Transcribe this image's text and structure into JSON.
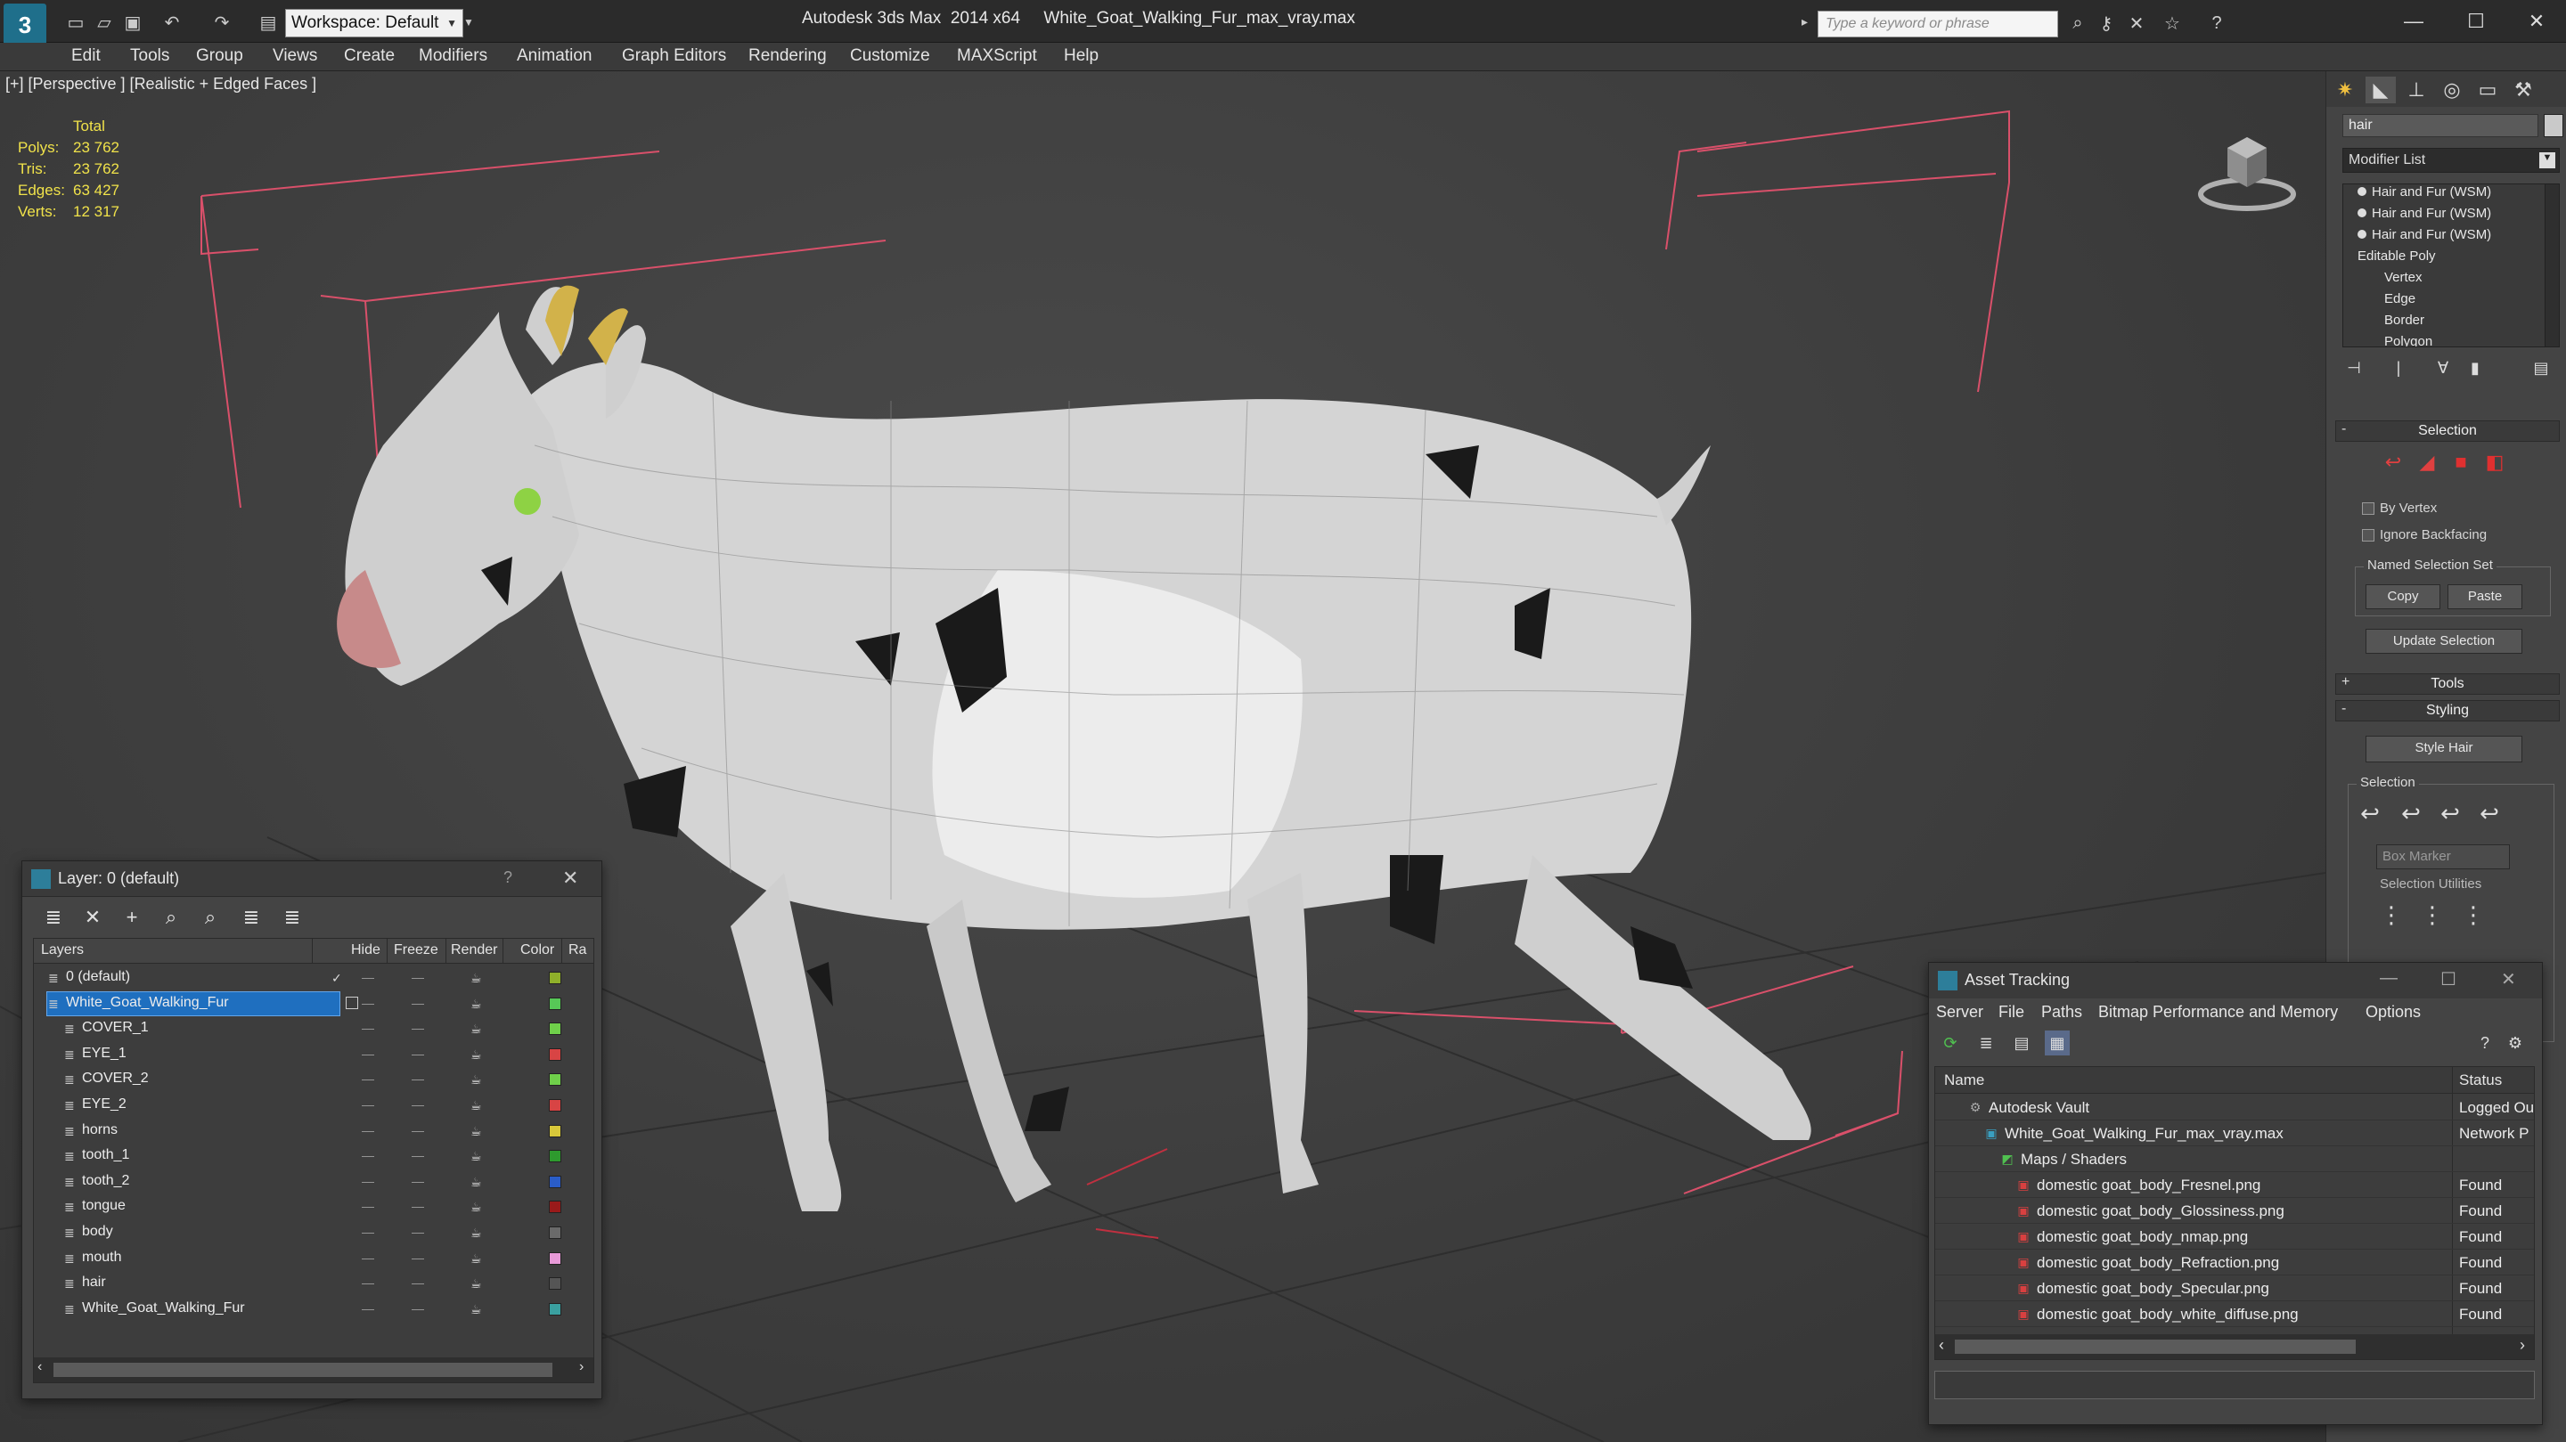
{
  "app": {
    "title": "Autodesk 3ds Max  2014 x64     White_Goat_Walking_Fur_max_vray.max",
    "workspace": "Workspace: Default",
    "search_placeholder": "Type a keyword or phrase"
  },
  "menus": [
    "Edit",
    "Tools",
    "Group",
    "Views",
    "Create",
    "Modifiers",
    "Animation",
    "Graph Editors",
    "Rendering",
    "Customize",
    "MAXScript",
    "Help"
  ],
  "viewport": {
    "label": "[+] [Perspective ] [Realistic + Edged Faces ]",
    "stats": {
      "header": "Total",
      "polys_label": "Polys:",
      "polys": "23 762",
      "tris_label": "Tris:",
      "tris": "23 762",
      "edges_label": "Edges:",
      "edges": "63 427",
      "verts_label": "Verts:",
      "verts": "12 317"
    }
  },
  "command_panel": {
    "object_name": "hair",
    "modifier_list": "Modifier List",
    "stack": [
      "Hair and Fur (WSM)",
      "Hair and Fur (WSM)",
      "Hair and Fur (WSM)",
      "Editable Poly",
      "Vertex",
      "Edge",
      "Border",
      "Polygon"
    ],
    "selection_rollout": "Selection",
    "by_vertex": "By Vertex",
    "ignore_backfacing": "Ignore Backfacing",
    "named_selection_set": "Named Selection Set",
    "copy": "Copy",
    "paste": "Paste",
    "update_selection": "Update Selection",
    "tools_rollout": "Tools",
    "styling_rollout": "Styling",
    "style_hair": "Style Hair",
    "selection_group": "Selection",
    "box_marker": "Box Marker",
    "selection_utilities": "Selection Utilities"
  },
  "layer_dialog": {
    "title": "Layer: 0 (default)",
    "help": "?",
    "columns": [
      "Layers",
      "Hide",
      "Freeze",
      "Render",
      "Color",
      "Ra"
    ],
    "rows": [
      {
        "name": "0 (default)",
        "color": "#8fb02a",
        "level": 0
      },
      {
        "name": "White_Goat_Walking_Fur",
        "color": "#57c857",
        "level": 0
      },
      {
        "name": "COVER_1",
        "color": "#6fd04a",
        "level": 1
      },
      {
        "name": "EYE_1",
        "color": "#d84444",
        "level": 1
      },
      {
        "name": "COVER_2",
        "color": "#6fd04a",
        "level": 1
      },
      {
        "name": "EYE_2",
        "color": "#d84444",
        "level": 1
      },
      {
        "name": "horns",
        "color": "#d8c83a",
        "level": 1
      },
      {
        "name": "tooth_1",
        "color": "#2e9a2e",
        "level": 1
      },
      {
        "name": "tooth_2",
        "color": "#2a5dc8",
        "level": 1
      },
      {
        "name": "tongue",
        "color": "#9a1a1a",
        "level": 1
      },
      {
        "name": "body",
        "color": "#6a6a6a",
        "level": 1
      },
      {
        "name": "mouth",
        "color": "#e89ad8",
        "level": 1
      },
      {
        "name": "hair",
        "color": "#555555",
        "level": 1
      },
      {
        "name": "White_Goat_Walking_Fur",
        "color": "#3aa0a0",
        "level": 1
      }
    ]
  },
  "asset_tracking": {
    "title": "Asset Tracking",
    "menus": [
      "Server",
      "File",
      "Paths",
      "Bitmap Performance and Memory",
      "Options"
    ],
    "col_name": "Name",
    "col_status": "Status",
    "rows": [
      {
        "name": "Autodesk Vault",
        "status": "Logged Ou",
        "level": 1,
        "icon": "vault"
      },
      {
        "name": "White_Goat_Walking_Fur_max_vray.max",
        "status": "Network P",
        "level": 2,
        "icon": "max"
      },
      {
        "name": "Maps / Shaders",
        "status": "",
        "level": 3,
        "icon": "maps"
      },
      {
        "name": "domestic goat_body_Fresnel.png",
        "status": "Found",
        "level": 4,
        "icon": "png"
      },
      {
        "name": "domestic goat_body_Glossiness.png",
        "status": "Found",
        "level": 4,
        "icon": "png"
      },
      {
        "name": "domestic goat_body_nmap.png",
        "status": "Found",
        "level": 4,
        "icon": "png"
      },
      {
        "name": "domestic goat_body_Refraction.png",
        "status": "Found",
        "level": 4,
        "icon": "png"
      },
      {
        "name": "domestic goat_body_Specular.png",
        "status": "Found",
        "level": 4,
        "icon": "png"
      },
      {
        "name": "domestic goat_body_white_diffuse.png",
        "status": "Found",
        "level": 4,
        "icon": "png"
      }
    ]
  }
}
